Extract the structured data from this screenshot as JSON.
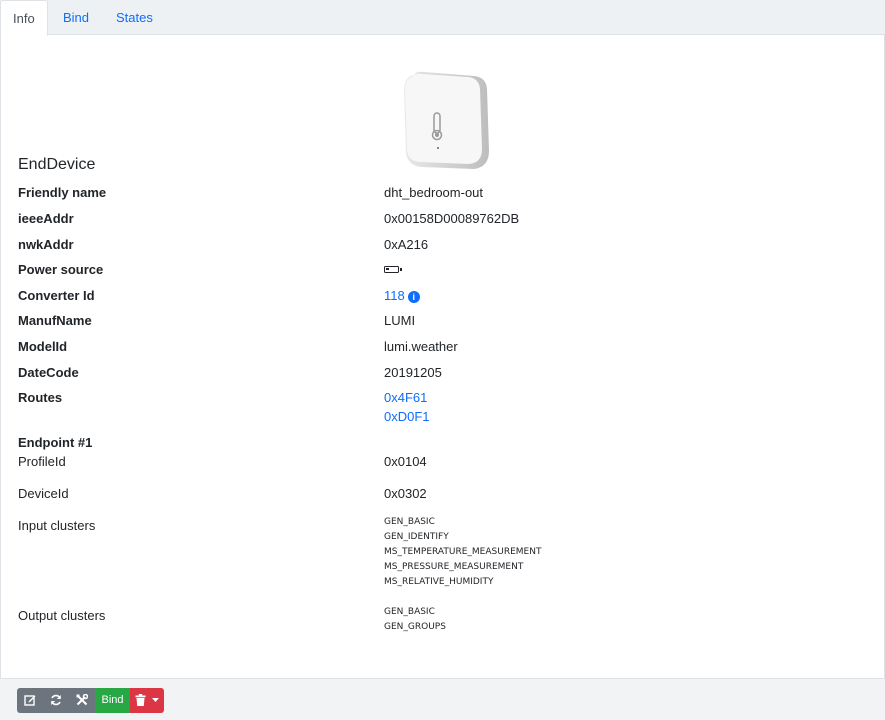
{
  "tabs": [
    {
      "label": "Info"
    },
    {
      "label": "Bind"
    },
    {
      "label": "States"
    }
  ],
  "device": {
    "type": "EndDevice",
    "image_alt": "Aqara temperature humidity sensor",
    "rows": {
      "friendly_name": {
        "label": "Friendly name",
        "value": "dht_bedroom-out"
      },
      "ieee_addr": {
        "label": "ieeeAddr",
        "value": "0x00158D00089762DB"
      },
      "nwk_addr": {
        "label": "nwkAddr",
        "value": "0xA216"
      },
      "power_source": {
        "label": "Power source",
        "icon": "battery-icon"
      },
      "converter_id": {
        "label": "Converter Id",
        "value": "118"
      },
      "manuf_name": {
        "label": "ManufName",
        "value": "LUMI"
      },
      "model_id": {
        "label": "ModelId",
        "value": "lumi.weather"
      },
      "date_code": {
        "label": "DateCode",
        "value": "20191205"
      },
      "routes": {
        "label": "Routes",
        "values": [
          "0x4F61",
          "0xD0F1"
        ]
      }
    },
    "endpoint": {
      "title": "Endpoint #1",
      "profile_label": "ProfileId",
      "profile_value": "0x0104",
      "device_label": "DeviceId",
      "device_value": "0x0302",
      "input_label": "Input clusters",
      "input_clusters": [
        "GEN_BASIC",
        "GEN_IDENTIFY",
        "MS_TEMPERATURE_MEASUREMENT",
        "MS_PRESSURE_MEASUREMENT",
        "MS_RELATIVE_HUMIDITY"
      ],
      "output_label": "Output clusters",
      "output_clusters": [
        "GEN_BASIC",
        "GEN_GROUPS"
      ]
    }
  },
  "footer": {
    "edit_icon": "edit-icon",
    "refresh_icon": "refresh-icon",
    "tools_icon": "tools-icon",
    "bind_label": "Bind",
    "delete_icon": "trash-icon"
  },
  "colors": {
    "link": "#0d6efd",
    "bind_button": "#28a745",
    "delete_button": "#dc3545",
    "secondary_button": "#6c757d"
  }
}
